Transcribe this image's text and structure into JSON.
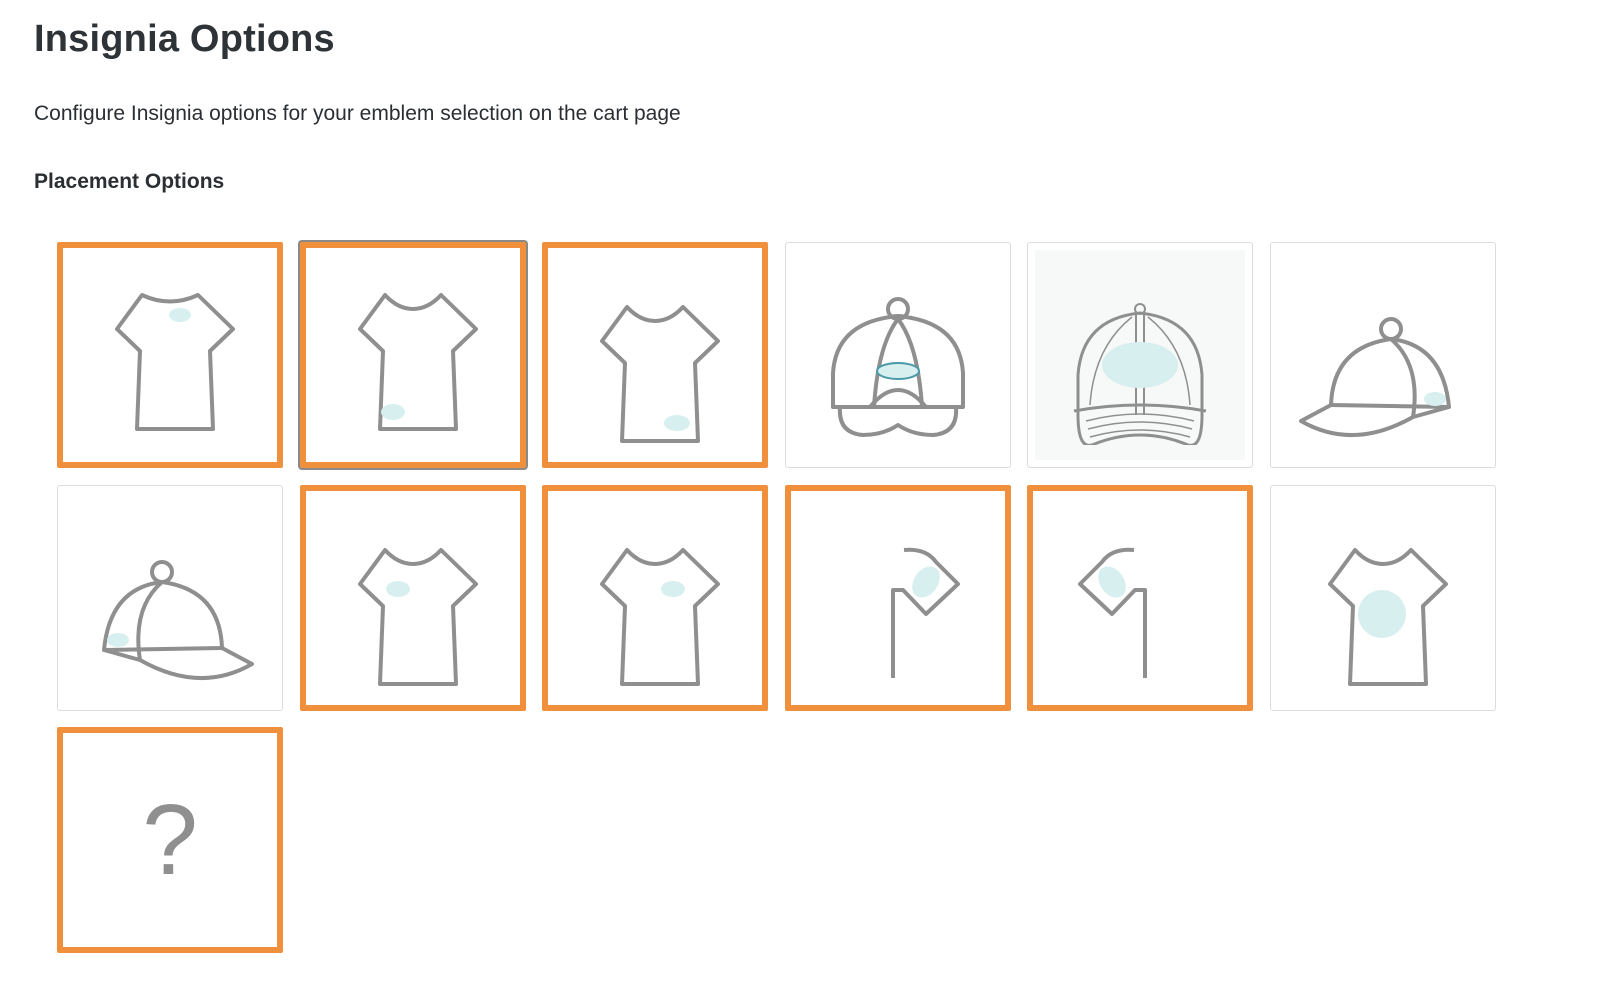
{
  "header": {
    "title": "Insignia Options",
    "description": "Configure Insignia options for your emblem selection on the cart page"
  },
  "section": {
    "title": "Placement Options"
  },
  "colors": {
    "selected_border": "#f0903c",
    "placement_marker": "#d8efef",
    "garment_outline": "#8f8f8f"
  },
  "placement_options": [
    {
      "icon": "tshirt-center-chest-icon",
      "selected": true
    },
    {
      "icon": "tshirt-bottom-left-icon",
      "selected": true,
      "focused": true
    },
    {
      "icon": "tshirt-bottom-right-icon",
      "selected": true
    },
    {
      "icon": "cap-back-icon",
      "selected": false
    },
    {
      "icon": "cap-front-center-icon",
      "selected": false
    },
    {
      "icon": "cap-right-side-icon",
      "selected": false
    },
    {
      "icon": "cap-left-side-icon",
      "selected": false
    },
    {
      "icon": "tshirt-left-chest-icon",
      "selected": true
    },
    {
      "icon": "tshirt-right-chest-icon",
      "selected": true
    },
    {
      "icon": "sleeve-right-icon",
      "selected": true
    },
    {
      "icon": "sleeve-left-icon",
      "selected": true
    },
    {
      "icon": "tshirt-full-front-icon",
      "selected": false
    },
    {
      "icon": "custom-placement-icon",
      "selected": true,
      "label": "?"
    }
  ]
}
